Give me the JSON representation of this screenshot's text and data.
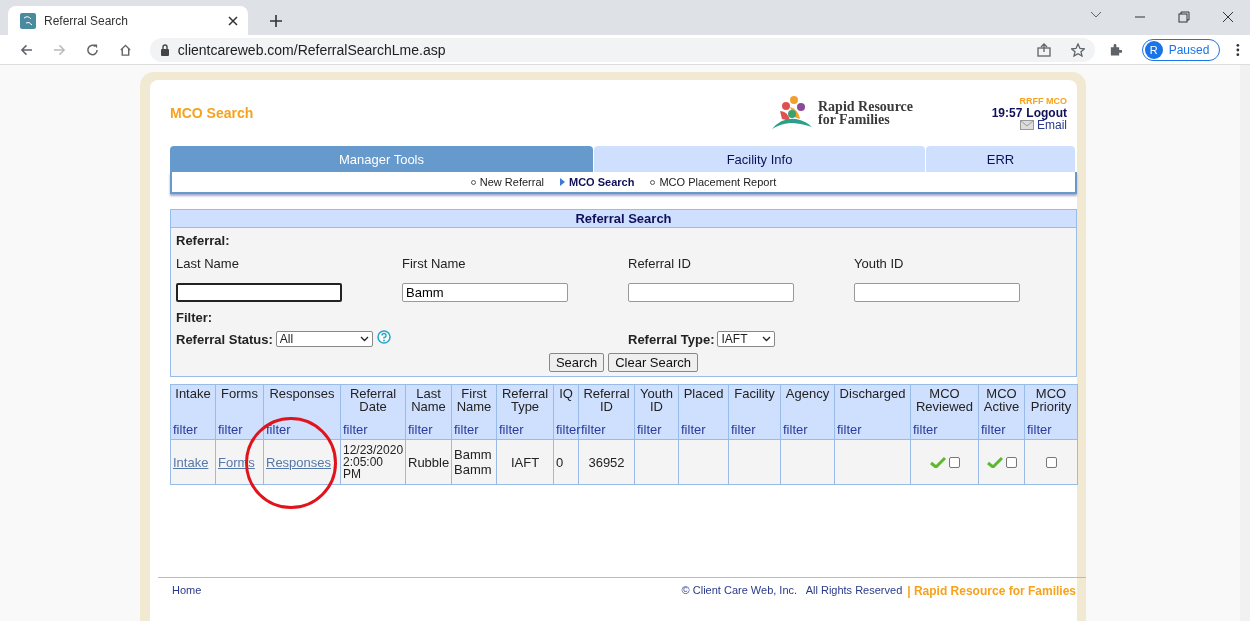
{
  "browser": {
    "tab_title": "Referral Search",
    "url": "clientcareweb.com/ReferralSearchLme.asp",
    "profile_initial": "R",
    "profile_status": "Paused"
  },
  "header": {
    "title": "MCO Search",
    "logo_line1": "Rapid Resource",
    "logo_line2": "for Families",
    "user": "RRFF MCO",
    "time": "19:57",
    "logout": "Logout",
    "email": "Email"
  },
  "tabs": [
    {
      "label": "Manager Tools",
      "selected": true
    },
    {
      "label": "Facility Info",
      "selected": false
    },
    {
      "label": "ERR",
      "selected": false
    }
  ],
  "subnav": [
    {
      "label": "New Referral",
      "selected": false
    },
    {
      "label": "MCO Search",
      "selected": true
    },
    {
      "label": "MCO Placement Report",
      "selected": false
    }
  ],
  "search": {
    "title": "Referral Search",
    "referral_heading": "Referral:",
    "fields": [
      {
        "label": "Last Name",
        "focused": true
      },
      {
        "label": "First Name",
        "value": "Bamm",
        "focused": false
      },
      {
        "label": "Referral ID",
        "focused": false
      },
      {
        "label": "Youth ID",
        "focused": false
      }
    ],
    "filter_heading": "Filter:",
    "status": {
      "label": "Referral Status:",
      "value": "All"
    },
    "type": {
      "label": "Referral Type:",
      "value": "IAFT"
    },
    "buttons": [
      "Search",
      "Clear Search"
    ]
  },
  "table": {
    "columns": [
      {
        "label": "Intake",
        "filter": "filter"
      },
      {
        "label": "Forms",
        "filter": "filter"
      },
      {
        "label": "Responses",
        "filter": "filter"
      },
      {
        "label": "Referral Date",
        "filter": "filter"
      },
      {
        "label": "Last Name",
        "filter": "filter"
      },
      {
        "label": "First Name",
        "filter": "filter"
      },
      {
        "label": "Referral Type",
        "filter": "filter"
      },
      {
        "label": "IQ",
        "filter": "filter"
      },
      {
        "label": "Referral ID",
        "filter": "filter"
      },
      {
        "label": "Youth ID",
        "filter": "filter"
      },
      {
        "label": "Placed",
        "filter": "filter"
      },
      {
        "label": "Facility",
        "filter": "filter"
      },
      {
        "label": "Agency",
        "filter": "filter"
      },
      {
        "label": "Discharged",
        "filter": "filter"
      },
      {
        "label": "MCO Reviewed",
        "filter": "filter"
      },
      {
        "label": "MCO Active",
        "filter": "filter"
      },
      {
        "label": "MCO Priority",
        "filter": "filter"
      }
    ],
    "rows": [
      {
        "cells": [
          {
            "kind": "link",
            "text": "Intake"
          },
          {
            "kind": "link",
            "text": "Forms"
          },
          {
            "kind": "link",
            "text": "Responses"
          },
          {
            "kind": "text",
            "text": "12/23/2020 2:05:00 PM"
          },
          {
            "kind": "text",
            "text": "Rubble"
          },
          {
            "kind": "text",
            "text": "Bamm Bamm"
          },
          {
            "kind": "text",
            "text": "IAFT"
          },
          {
            "kind": "text",
            "text": "0"
          },
          {
            "kind": "text",
            "text": "36952"
          },
          {
            "kind": "empty"
          },
          {
            "kind": "empty"
          },
          {
            "kind": "empty"
          },
          {
            "kind": "empty"
          },
          {
            "kind": "empty"
          },
          {
            "kind": "check",
            "tick": true,
            "checked": false
          },
          {
            "kind": "check",
            "tick": true,
            "checked": false
          },
          {
            "kind": "check",
            "tick": false,
            "checked": false
          }
        ]
      }
    ]
  },
  "footer": {
    "home": "Home",
    "copyright": "© Client Care Web, Inc.   All Rights Reserved",
    "brand": "| Rapid Resource for Families"
  }
}
